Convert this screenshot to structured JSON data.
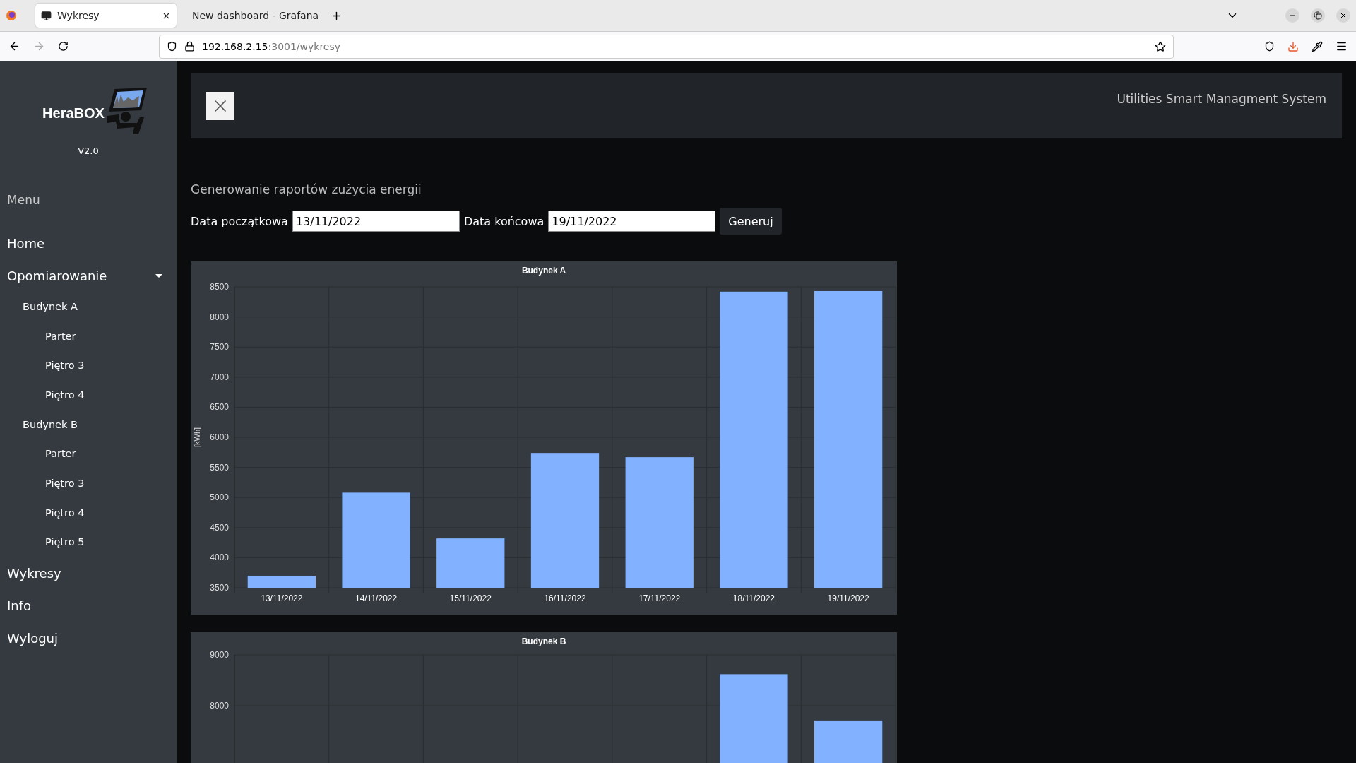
{
  "browser": {
    "tabs": [
      {
        "title": "Wykresy",
        "kind": "monitor",
        "selected": true
      },
      {
        "title": "New dashboard - Grafana",
        "kind": "grafana",
        "selected": false
      }
    ],
    "url_host": "192.168.2.15",
    "url_rest": ":3001/wykresy"
  },
  "sidebar": {
    "logo_text": "HeraBOX",
    "version": "V2.0",
    "menu_label": "Menu",
    "items": [
      {
        "label": "Home"
      },
      {
        "label": "Opomiarowanie",
        "expanded": true,
        "children": [
          {
            "label": "Budynek A",
            "children": [
              {
                "label": "Parter"
              },
              {
                "label": "Piętro 3"
              },
              {
                "label": "Piętro 4"
              }
            ]
          },
          {
            "label": "Budynek B",
            "children": [
              {
                "label": "Parter"
              },
              {
                "label": "Piętro 3"
              },
              {
                "label": "Piętro 4"
              },
              {
                "label": "Piętro 5"
              }
            ]
          }
        ]
      },
      {
        "label": "Wykresy"
      },
      {
        "label": "Info"
      },
      {
        "label": "Wyloguj"
      }
    ]
  },
  "header": {
    "title": "Utilities Smart Managment System"
  },
  "report": {
    "heading": "Generowanie raportów zużycia energii",
    "start_label": "Data początkowa",
    "start_value": "13/11/2022",
    "end_label": "Data końcowa",
    "end_value": "19/11/2022",
    "button": "Generuj"
  },
  "charts": [
    {
      "chart_data": {
        "type": "bar",
        "title": "Budynek A",
        "ylabel": "[kWh]",
        "categories": [
          "13/11/2022",
          "14/11/2022",
          "15/11/2022",
          "16/11/2022",
          "17/11/2022",
          "18/11/2022",
          "19/11/2022"
        ],
        "grid": true,
        "series": [
          {
            "color": "#82b2ff",
            "values": [
              3700,
              5080,
              4320,
              5740,
              5670,
              8420,
              8430
            ]
          }
        ],
        "ylim": [
          3500,
          8500
        ],
        "yticks": [
          3500,
          4000,
          4500,
          5000,
          5500,
          6000,
          6500,
          7000,
          7500,
          8000,
          8500
        ]
      }
    },
    {
      "chart_data": {
        "type": "bar",
        "title": "Budynek B",
        "grid": true,
        "series": [
          {
            "color": "#82b2ff",
            "values": [
              null,
              null,
              null,
              null,
              null,
              8620,
              7710
            ]
          }
        ],
        "ylim": [
          3000,
          9000
        ],
        "yticks": [
          8000,
          9000
        ]
      }
    }
  ]
}
